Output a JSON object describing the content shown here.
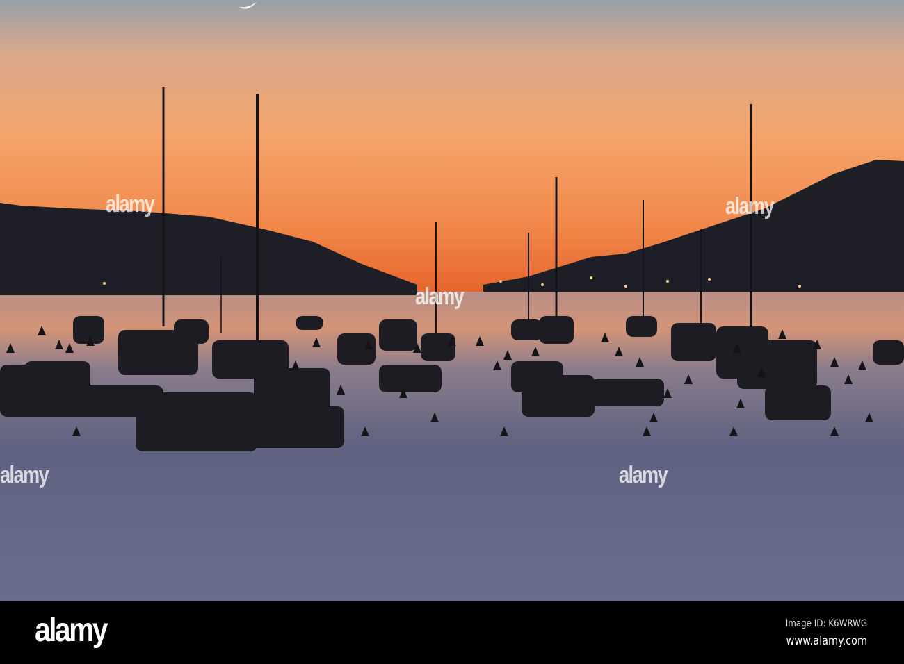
{
  "photo": {
    "subject": "sunset harbor"
  },
  "watermark": {
    "text": "alamy"
  },
  "footer": {
    "logo": "alamy",
    "image_id": "Image ID: K6WRWG",
    "url": "www.alamy.com"
  },
  "colors": {
    "sky_top": "#98a0a8",
    "sky_mid": "#f0a26a",
    "horizon": "#e8602a",
    "water": "#5d5f7c",
    "silhouette": "#1e1f26"
  }
}
